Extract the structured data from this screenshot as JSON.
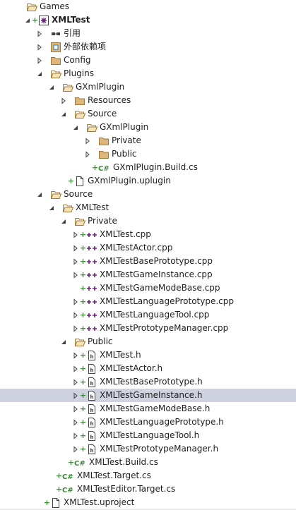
{
  "colors": {
    "selected_row": "#cfd3df",
    "folder_outline": "#9b7a3b",
    "folder_fill": "#dcb67a",
    "cs_green": "#388a34",
    "cpp_purple": "#68217a"
  },
  "tree": [
    {
      "label": "Games",
      "depth": 0,
      "expander": "none",
      "plus": false,
      "icon": "folder-open-icon",
      "name": "folder-games"
    },
    {
      "label": "XMLTest",
      "depth": 1,
      "expander": "down",
      "plus": true,
      "icon": "cpp-project-icon",
      "name": "project-xmltest",
      "bold": true
    },
    {
      "label": "引用",
      "depth": 2,
      "expander": "right",
      "plus": false,
      "icon": "references-icon",
      "name": "references-node"
    },
    {
      "label": "外部依赖项",
      "depth": 2,
      "expander": "right",
      "plus": false,
      "icon": "external-deps-icon",
      "name": "external-dependencies-node"
    },
    {
      "label": "Config",
      "depth": 2,
      "expander": "right",
      "plus": false,
      "icon": "folder-icon",
      "name": "folder-config"
    },
    {
      "label": "Plugins",
      "depth": 2,
      "expander": "down",
      "plus": false,
      "icon": "folder-open-icon",
      "name": "folder-plugins"
    },
    {
      "label": "GXmlPlugin",
      "depth": 3,
      "expander": "down",
      "plus": false,
      "icon": "folder-open-icon",
      "name": "folder-gxmlplugin"
    },
    {
      "label": "Resources",
      "depth": 4,
      "expander": "right",
      "plus": false,
      "icon": "folder-icon",
      "name": "folder-resources"
    },
    {
      "label": "Source",
      "depth": 4,
      "expander": "down",
      "plus": false,
      "icon": "folder-open-icon",
      "name": "folder-plugin-source"
    },
    {
      "label": "GXmlPlugin",
      "depth": 5,
      "expander": "down",
      "plus": false,
      "icon": "folder-open-icon",
      "name": "folder-gxmlplugin-src"
    },
    {
      "label": "Private",
      "depth": 6,
      "expander": "right",
      "plus": false,
      "icon": "folder-icon",
      "name": "folder-plugin-private"
    },
    {
      "label": "Public",
      "depth": 6,
      "expander": "right",
      "plus": false,
      "icon": "folder-icon",
      "name": "folder-plugin-public"
    },
    {
      "label": "GXmlPlugin.Build.cs",
      "depth": 6,
      "expander": "none",
      "plus": true,
      "icon": "csharp-file-icon",
      "name": "file-gxmlplugin-build-cs"
    },
    {
      "label": "GXmlPlugin.uplugin",
      "depth": 4,
      "expander": "none",
      "plus": true,
      "icon": "plain-file-icon",
      "name": "file-gxmlplugin-uplugin"
    },
    {
      "label": "Source",
      "depth": 2,
      "expander": "down",
      "plus": false,
      "icon": "folder-open-icon",
      "name": "folder-source"
    },
    {
      "label": "XMLTest",
      "depth": 3,
      "expander": "down",
      "plus": false,
      "icon": "folder-open-icon",
      "name": "folder-xmltest"
    },
    {
      "label": "Private",
      "depth": 4,
      "expander": "down",
      "plus": false,
      "icon": "folder-open-icon",
      "name": "folder-private"
    },
    {
      "label": "XMLTest.cpp",
      "depth": 5,
      "expander": "right",
      "plus": true,
      "icon": "cpp-file-icon",
      "name": "file-xmltest-cpp"
    },
    {
      "label": "XMLTestActor.cpp",
      "depth": 5,
      "expander": "right",
      "plus": true,
      "icon": "cpp-file-icon",
      "name": "file-xmltestactor-cpp"
    },
    {
      "label": "XMLTestBasePrototype.cpp",
      "depth": 5,
      "expander": "right",
      "plus": true,
      "icon": "cpp-file-icon",
      "name": "file-xmltestbaseprototype-cpp"
    },
    {
      "label": "XMLTestGameInstance.cpp",
      "depth": 5,
      "expander": "right",
      "plus": true,
      "icon": "cpp-file-icon",
      "name": "file-xmltestgameinstance-cpp"
    },
    {
      "label": "XMLTestGameModeBase.cpp",
      "depth": 5,
      "expander": "none",
      "plus": true,
      "icon": "cpp-file-icon",
      "name": "file-xmltestgamemodebase-cpp"
    },
    {
      "label": "XMLTestLanguagePrototype.cpp",
      "depth": 5,
      "expander": "right",
      "plus": true,
      "icon": "cpp-file-icon",
      "name": "file-xmltestlanguageprototype-cpp"
    },
    {
      "label": "XMLTestLanguageTool.cpp",
      "depth": 5,
      "expander": "right",
      "plus": true,
      "icon": "cpp-file-icon",
      "name": "file-xmltestlanguagetool-cpp"
    },
    {
      "label": "XMLTestPrototypeManager.cpp",
      "depth": 5,
      "expander": "right",
      "plus": true,
      "icon": "cpp-file-icon",
      "name": "file-xmltestprototypemanager-cpp"
    },
    {
      "label": "Public",
      "depth": 4,
      "expander": "down",
      "plus": false,
      "icon": "folder-open-icon",
      "name": "folder-public"
    },
    {
      "label": "XMLTest.h",
      "depth": 5,
      "expander": "right",
      "plus": true,
      "icon": "header-file-icon",
      "name": "file-xmltest-h"
    },
    {
      "label": "XMLTestActor.h",
      "depth": 5,
      "expander": "right",
      "plus": true,
      "icon": "header-file-icon",
      "name": "file-xmltestactor-h"
    },
    {
      "label": "XMLTestBasePrototype.h",
      "depth": 5,
      "expander": "right",
      "plus": true,
      "icon": "header-file-icon",
      "name": "file-xmltestbaseprototype-h"
    },
    {
      "label": "XMLTestGameInstance.h",
      "depth": 5,
      "expander": "right",
      "plus": true,
      "icon": "header-file-icon",
      "name": "file-xmltestgameinstance-h",
      "selected": true
    },
    {
      "label": "XMLTestGameModeBase.h",
      "depth": 5,
      "expander": "right",
      "plus": true,
      "icon": "header-file-icon",
      "name": "file-xmltestgamemodebase-h"
    },
    {
      "label": "XMLTestLanguagePrototype.h",
      "depth": 5,
      "expander": "right",
      "plus": true,
      "icon": "header-file-icon",
      "name": "file-xmltestlanguageprototype-h"
    },
    {
      "label": "XMLTestLanguageTool.h",
      "depth": 5,
      "expander": "right",
      "plus": true,
      "icon": "header-file-icon",
      "name": "file-xmltestlanguagetool-h"
    },
    {
      "label": "XMLTestPrototypeManager.h",
      "depth": 5,
      "expander": "right",
      "plus": true,
      "icon": "header-file-icon",
      "name": "file-xmltestprototypemanager-h"
    },
    {
      "label": "XMLTest.Build.cs",
      "depth": 4,
      "expander": "none",
      "plus": true,
      "icon": "csharp-file-icon",
      "name": "file-xmltest-build-cs"
    },
    {
      "label": "XMLTest.Target.cs",
      "depth": 3,
      "expander": "none",
      "plus": true,
      "icon": "csharp-file-icon",
      "name": "file-xmltest-target-cs"
    },
    {
      "label": "XMLTestEditor.Target.cs",
      "depth": 3,
      "expander": "none",
      "plus": true,
      "icon": "csharp-file-icon",
      "name": "file-xmltesteditor-target-cs"
    },
    {
      "label": "XMLTest.uproject",
      "depth": 2,
      "expander": "none",
      "plus": true,
      "icon": "plain-file-icon",
      "name": "file-xmltest-uproject"
    }
  ]
}
